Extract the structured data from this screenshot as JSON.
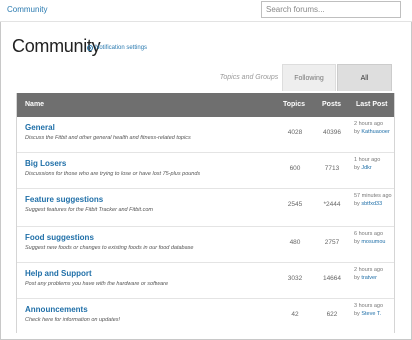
{
  "breadcrumb": {
    "label": "Community"
  },
  "search": {
    "placeholder": "Search forums..."
  },
  "header": {
    "title": "Community",
    "notification_link": "Notification settings"
  },
  "tabs": [
    {
      "label": "Topics and Groups",
      "state": "inactive"
    },
    {
      "label": "Following",
      "state": "inactive"
    },
    {
      "label": "All",
      "state": "active"
    }
  ],
  "table": {
    "columns": {
      "name": "Name",
      "topics": "Topics",
      "posts": "Posts",
      "last_post": "Last Post"
    },
    "rows": [
      {
        "title": "General",
        "description": "Discuss the Fitbit and other general health and fitness-related topics",
        "topics": "4028",
        "posts": "40396",
        "last_time": "2 hours ago",
        "last_by": "by",
        "last_user": "Kathuaooer"
      },
      {
        "title": "Big Losers",
        "description": "Discussions for those who are trying to lose or have lost 75-plus pounds",
        "topics": "600",
        "posts": "7713",
        "last_time": "1 hour ago",
        "last_by": "by",
        "last_user": "Jdkr"
      },
      {
        "title": "Feature suggestions",
        "description": "Suggest features for the Fitbit Tracker and Fitbit.com",
        "topics": "2545",
        "posts": "*2444",
        "last_time": "57 minutes ago",
        "last_by": "by",
        "last_user": "sbtfxd33"
      },
      {
        "title": "Food suggestions",
        "description": "Suggest new foods or changes to existing foods in our food database",
        "topics": "480",
        "posts": "2757",
        "last_time": "6 hours ago",
        "last_by": "by",
        "last_user": "mosumou"
      },
      {
        "title": "Help and Support",
        "description": "Post any problems you have with the hardware or software",
        "topics": "3032",
        "posts": "14664",
        "last_time": "2 hours ago",
        "last_by": "by",
        "last_user": "tratver"
      },
      {
        "title": "Announcements",
        "description": "Check here for information on updates!",
        "topics": "42",
        "posts": "622",
        "last_time": "3 hours ago",
        "last_by": "by",
        "last_user": "Steve T."
      }
    ]
  },
  "colors": {
    "link": "#1f6fa8",
    "header_bg": "#6f6f6f",
    "active_tab": "#dedede"
  }
}
